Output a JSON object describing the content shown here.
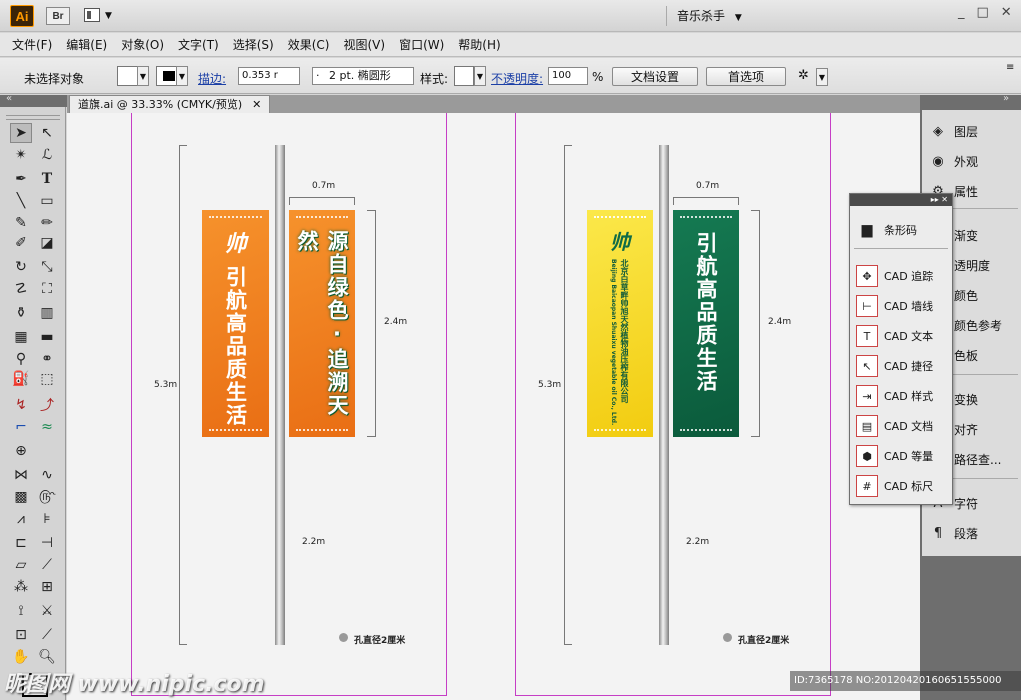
{
  "app": {
    "logo": "Ai",
    "bridge": "Br",
    "workspace": "音乐杀手",
    "win_min": "_",
    "win_max": "□",
    "win_close": "✕"
  },
  "menu": [
    "文件(F)",
    "编辑(E)",
    "对象(O)",
    "文字(T)",
    "选择(S)",
    "效果(C)",
    "视图(V)",
    "窗口(W)",
    "帮助(H)"
  ],
  "control": {
    "selection": "未选择对象",
    "stroke_label": "描边:",
    "stroke_value": "0.353 r",
    "brush_value": "2 pt. 椭圆形",
    "brush_dot": "·",
    "style_label": "样式:",
    "opacity_label": "不透明度:",
    "opacity_value": "100",
    "opacity_unit": "%",
    "doc_setup": "文档设置",
    "preferences": "首选项"
  },
  "document": {
    "tab_title": "道旗.ai @ 33.33% (CMYK/预览)",
    "tab_close": "✕"
  },
  "artwork": {
    "left": {
      "total_height": "5.3m",
      "width": "0.7m",
      "banner_height": "2.4m",
      "pole_bottom": "2.2m",
      "hole_note": "孔直径2厘米",
      "banner1_logo": "帅",
      "banner1_text": "引航高品质生活",
      "banner2_text": "源自绿色·追溯天然"
    },
    "right": {
      "total_height": "5.3m",
      "width": "0.7m",
      "banner_height": "2.4m",
      "pole_bottom": "2.2m",
      "hole_note": "孔直径2厘米",
      "banner1_logo": "帅",
      "banner1_text_cn": "北京白草畔帅旭天然植物油压榨有限公司",
      "banner1_text_en": "Beijing Baicaopan Shuaixu vegetable oil Co., Ltd.",
      "banner2_text": "引航高品质生活"
    },
    "colors": {
      "orange": "#f07a1e",
      "yellow": "#f6d81a",
      "green": "#0f6b47"
    }
  },
  "dock": {
    "items": [
      {
        "label": "图层",
        "icon": "layers-icon"
      },
      {
        "label": "外观",
        "icon": "appearance-icon"
      },
      {
        "label": "属性",
        "icon": "attributes-icon"
      },
      {
        "label": "渐变",
        "icon": "gradient-icon"
      },
      {
        "label": "透明度",
        "icon": "transparency-icon"
      },
      {
        "label": "颜色",
        "icon": "color-icon"
      },
      {
        "label": "颜色参考",
        "icon": "color-guide-icon"
      },
      {
        "label": "色板",
        "icon": "swatches-icon"
      },
      {
        "label": "变换",
        "icon": "transform-icon"
      },
      {
        "label": "对齐",
        "icon": "align-icon"
      },
      {
        "label": "路径查...",
        "icon": "pathfinder-icon"
      },
      {
        "label": "字符",
        "icon": "character-icon"
      },
      {
        "label": "段落",
        "icon": "paragraph-icon"
      }
    ]
  },
  "cad_panel": {
    "header": "▸▸ ✕",
    "items": [
      {
        "label": "条形码",
        "icon": "barcode-icon"
      },
      {
        "label": "CAD 追踪",
        "icon": "cad-trace-icon"
      },
      {
        "label": "CAD 墙线",
        "icon": "cad-wall-icon"
      },
      {
        "label": "CAD 文本",
        "icon": "cad-text-icon"
      },
      {
        "label": "CAD 捷径",
        "icon": "cad-shortcut-icon"
      },
      {
        "label": "CAD 样式",
        "icon": "cad-style-icon"
      },
      {
        "label": "CAD 文档",
        "icon": "cad-doc-icon"
      },
      {
        "label": "CAD 等量",
        "icon": "cad-equal-icon"
      },
      {
        "label": "CAD 标尺",
        "icon": "cad-ruler-icon"
      }
    ]
  },
  "watermark": {
    "left": "昵图网 www.nipic.com",
    "right": "ID:7365178 NO:20120420160651555000"
  }
}
